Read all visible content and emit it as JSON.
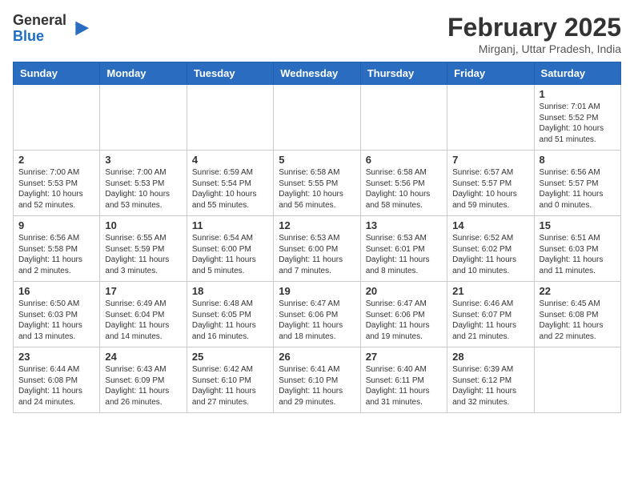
{
  "header": {
    "logo_general": "General",
    "logo_blue": "Blue",
    "month_title": "February 2025",
    "location": "Mirganj, Uttar Pradesh, India"
  },
  "weekdays": [
    "Sunday",
    "Monday",
    "Tuesday",
    "Wednesday",
    "Thursday",
    "Friday",
    "Saturday"
  ],
  "weeks": [
    [
      {
        "day": "",
        "info": ""
      },
      {
        "day": "",
        "info": ""
      },
      {
        "day": "",
        "info": ""
      },
      {
        "day": "",
        "info": ""
      },
      {
        "day": "",
        "info": ""
      },
      {
        "day": "",
        "info": ""
      },
      {
        "day": "1",
        "info": "Sunrise: 7:01 AM\nSunset: 5:52 PM\nDaylight: 10 hours\nand 51 minutes."
      }
    ],
    [
      {
        "day": "2",
        "info": "Sunrise: 7:00 AM\nSunset: 5:53 PM\nDaylight: 10 hours\nand 52 minutes."
      },
      {
        "day": "3",
        "info": "Sunrise: 7:00 AM\nSunset: 5:53 PM\nDaylight: 10 hours\nand 53 minutes."
      },
      {
        "day": "4",
        "info": "Sunrise: 6:59 AM\nSunset: 5:54 PM\nDaylight: 10 hours\nand 55 minutes."
      },
      {
        "day": "5",
        "info": "Sunrise: 6:58 AM\nSunset: 5:55 PM\nDaylight: 10 hours\nand 56 minutes."
      },
      {
        "day": "6",
        "info": "Sunrise: 6:58 AM\nSunset: 5:56 PM\nDaylight: 10 hours\nand 58 minutes."
      },
      {
        "day": "7",
        "info": "Sunrise: 6:57 AM\nSunset: 5:57 PM\nDaylight: 10 hours\nand 59 minutes."
      },
      {
        "day": "8",
        "info": "Sunrise: 6:56 AM\nSunset: 5:57 PM\nDaylight: 11 hours\nand 0 minutes."
      }
    ],
    [
      {
        "day": "9",
        "info": "Sunrise: 6:56 AM\nSunset: 5:58 PM\nDaylight: 11 hours\nand 2 minutes."
      },
      {
        "day": "10",
        "info": "Sunrise: 6:55 AM\nSunset: 5:59 PM\nDaylight: 11 hours\nand 3 minutes."
      },
      {
        "day": "11",
        "info": "Sunrise: 6:54 AM\nSunset: 6:00 PM\nDaylight: 11 hours\nand 5 minutes."
      },
      {
        "day": "12",
        "info": "Sunrise: 6:53 AM\nSunset: 6:00 PM\nDaylight: 11 hours\nand 7 minutes."
      },
      {
        "day": "13",
        "info": "Sunrise: 6:53 AM\nSunset: 6:01 PM\nDaylight: 11 hours\nand 8 minutes."
      },
      {
        "day": "14",
        "info": "Sunrise: 6:52 AM\nSunset: 6:02 PM\nDaylight: 11 hours\nand 10 minutes."
      },
      {
        "day": "15",
        "info": "Sunrise: 6:51 AM\nSunset: 6:03 PM\nDaylight: 11 hours\nand 11 minutes."
      }
    ],
    [
      {
        "day": "16",
        "info": "Sunrise: 6:50 AM\nSunset: 6:03 PM\nDaylight: 11 hours\nand 13 minutes."
      },
      {
        "day": "17",
        "info": "Sunrise: 6:49 AM\nSunset: 6:04 PM\nDaylight: 11 hours\nand 14 minutes."
      },
      {
        "day": "18",
        "info": "Sunrise: 6:48 AM\nSunset: 6:05 PM\nDaylight: 11 hours\nand 16 minutes."
      },
      {
        "day": "19",
        "info": "Sunrise: 6:47 AM\nSunset: 6:06 PM\nDaylight: 11 hours\nand 18 minutes."
      },
      {
        "day": "20",
        "info": "Sunrise: 6:47 AM\nSunset: 6:06 PM\nDaylight: 11 hours\nand 19 minutes."
      },
      {
        "day": "21",
        "info": "Sunrise: 6:46 AM\nSunset: 6:07 PM\nDaylight: 11 hours\nand 21 minutes."
      },
      {
        "day": "22",
        "info": "Sunrise: 6:45 AM\nSunset: 6:08 PM\nDaylight: 11 hours\nand 22 minutes."
      }
    ],
    [
      {
        "day": "23",
        "info": "Sunrise: 6:44 AM\nSunset: 6:08 PM\nDaylight: 11 hours\nand 24 minutes."
      },
      {
        "day": "24",
        "info": "Sunrise: 6:43 AM\nSunset: 6:09 PM\nDaylight: 11 hours\nand 26 minutes."
      },
      {
        "day": "25",
        "info": "Sunrise: 6:42 AM\nSunset: 6:10 PM\nDaylight: 11 hours\nand 27 minutes."
      },
      {
        "day": "26",
        "info": "Sunrise: 6:41 AM\nSunset: 6:10 PM\nDaylight: 11 hours\nand 29 minutes."
      },
      {
        "day": "27",
        "info": "Sunrise: 6:40 AM\nSunset: 6:11 PM\nDaylight: 11 hours\nand 31 minutes."
      },
      {
        "day": "28",
        "info": "Sunrise: 6:39 AM\nSunset: 6:12 PM\nDaylight: 11 hours\nand 32 minutes."
      },
      {
        "day": "",
        "info": ""
      }
    ]
  ]
}
